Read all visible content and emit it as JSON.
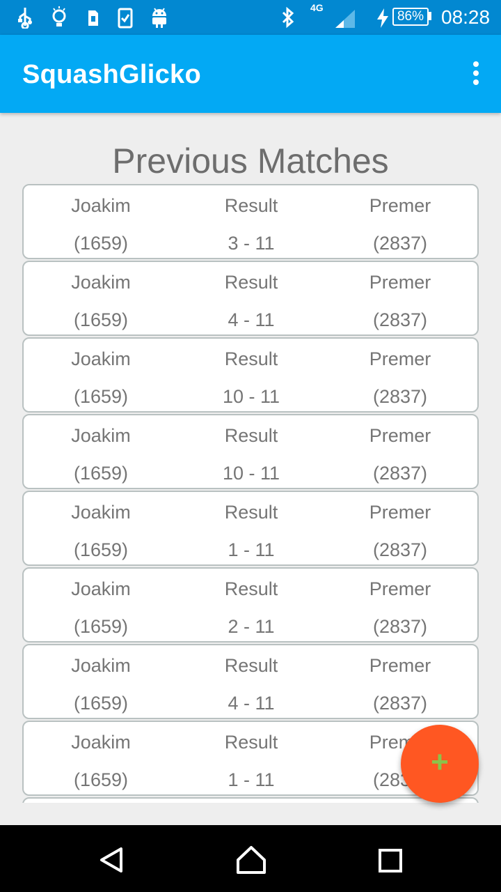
{
  "status_bar": {
    "network": "4G",
    "battery": "86%",
    "time": "08:28",
    "icons": [
      "usb-icon",
      "lightbulb-icon",
      "sim-card-icon",
      "clipboard-check-icon",
      "android-icon",
      "bluetooth-icon",
      "signal-icon",
      "charging-icon",
      "battery-icon"
    ]
  },
  "app_bar": {
    "title": "SquashGlicko"
  },
  "page": {
    "title": "Previous Matches"
  },
  "matches": [
    {
      "player": "Joakim",
      "player_rating": "(1659)",
      "result_label": "Result",
      "score": "3 - 11",
      "opponent": "Premer",
      "opponent_rating": "(2837)"
    },
    {
      "player": "Joakim",
      "player_rating": "(1659)",
      "result_label": "Result",
      "score": "4 - 11",
      "opponent": "Premer",
      "opponent_rating": "(2837)"
    },
    {
      "player": "Joakim",
      "player_rating": "(1659)",
      "result_label": "Result",
      "score": "10 - 11",
      "opponent": "Premer",
      "opponent_rating": "(2837)"
    },
    {
      "player": "Joakim",
      "player_rating": "(1659)",
      "result_label": "Result",
      "score": "10 - 11",
      "opponent": "Premer",
      "opponent_rating": "(2837)"
    },
    {
      "player": "Joakim",
      "player_rating": "(1659)",
      "result_label": "Result",
      "score": "1 - 11",
      "opponent": "Premer",
      "opponent_rating": "(2837)"
    },
    {
      "player": "Joakim",
      "player_rating": "(1659)",
      "result_label": "Result",
      "score": "2 - 11",
      "opponent": "Premer",
      "opponent_rating": "(2837)"
    },
    {
      "player": "Joakim",
      "player_rating": "(1659)",
      "result_label": "Result",
      "score": "4 - 11",
      "opponent": "Premer",
      "opponent_rating": "(2837)"
    },
    {
      "player": "Joakim",
      "player_rating": "(1659)",
      "result_label": "Result",
      "score": "1 - 11",
      "opponent": "Premer",
      "opponent_rating": "(2837)"
    },
    {
      "player": "",
      "player_rating": "",
      "result_label": "",
      "score": "",
      "opponent": "",
      "opponent_rating": ""
    }
  ],
  "fab": {
    "icon": "plus-icon",
    "label": "+"
  },
  "nav_bar": {
    "icons": [
      "back-icon",
      "home-icon",
      "recents-icon"
    ]
  },
  "colors": {
    "status_bar": "#0288d1",
    "app_bar": "#03a9f4",
    "fab": "#ff5722",
    "fab_icon": "#8bc34a",
    "background": "#eeeeee",
    "text": "#757575"
  }
}
